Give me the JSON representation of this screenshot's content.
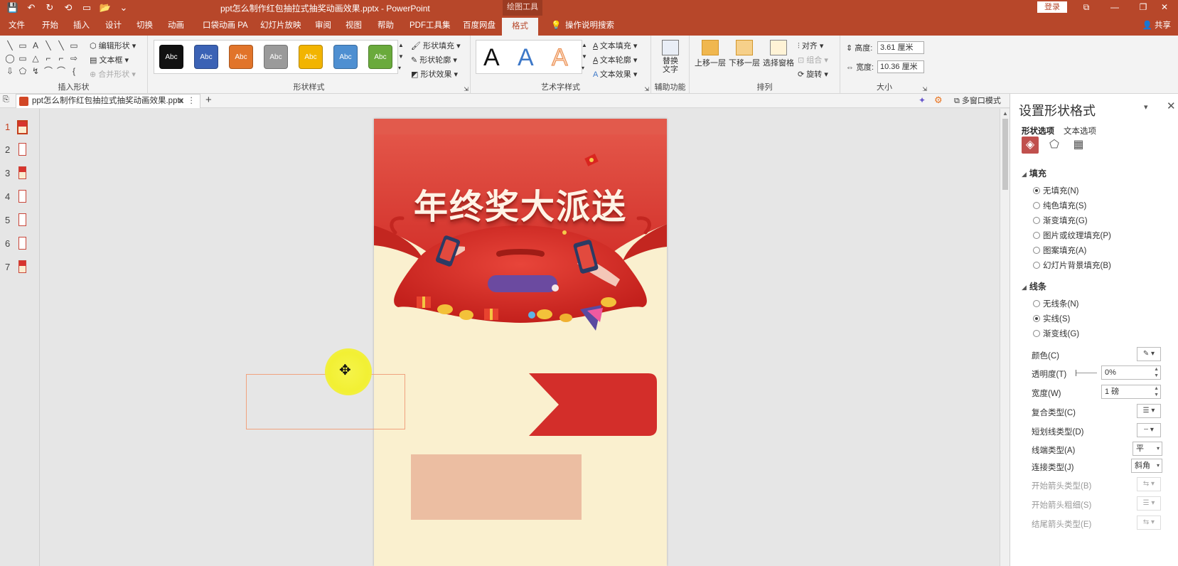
{
  "titlebar": {
    "doc_title": "ppt怎么制作红包抽拉式抽奖动画效果.pptx  -  PowerPoint",
    "context_tool": "绘图工具",
    "login": "登录",
    "minimize_icon": "⧉",
    "restore_icon": "❐",
    "close_icon": "✕",
    "qat": [
      "💾",
      "↶",
      "↻",
      "⟲",
      "▭",
      "📂",
      "⌄"
    ]
  },
  "menu": {
    "tabs": [
      "文件",
      "开始",
      "插入",
      "设计",
      "切换",
      "动画",
      "口袋动画 PA",
      "幻灯片放映",
      "审阅",
      "视图",
      "帮助",
      "PDF工具集",
      "百度网盘",
      "格式"
    ],
    "active": "格式",
    "tell_me": "操作说明搜索",
    "share": "共享"
  },
  "ribbon": {
    "insert_shapes": {
      "label": "插入形状",
      "edit_shape": "编辑形状",
      "text_box": "文本框",
      "merge_shapes": "合并形状",
      "shape_glyphs": [
        "╲",
        "▭",
        "A",
        "╲",
        "╲",
        "▭",
        "◯",
        "▭",
        "△",
        "⌐",
        "⌐",
        "⇨",
        "⇩",
        "⬠",
        "↯",
        "⌒",
        "⌒",
        "{"
      ]
    },
    "shape_styles": {
      "label": "形状样式",
      "swatch_label": "Abc",
      "swatches": [
        "#111111",
        "#3b62b5",
        "#e1742a",
        "#9a9a9a",
        "#f2b400",
        "#4e8fd1",
        "#6aaa3c"
      ],
      "fill": "形状填充",
      "outline": "形状轮廓",
      "effects": "形状效果"
    },
    "wordart": {
      "label": "艺术字样式",
      "letters": [
        {
          "char": "A",
          "color": "#111111"
        },
        {
          "char": "A",
          "color": "#3d78c8"
        },
        {
          "char": "A",
          "color": "#f2b48a"
        }
      ],
      "text_fill": "文本填充",
      "text_outline": "文本轮廓",
      "text_effects": "文本效果"
    },
    "accessibility": {
      "label": "辅助功能",
      "alt_text": "替换文字"
    },
    "arrange": {
      "label": "排列",
      "bring_forward": "上移一层",
      "send_backward": "下移一层",
      "selection_pane": "选择窗格",
      "align": "对齐",
      "group": "组合",
      "rotate": "旋转"
    },
    "size": {
      "label": "大小",
      "height_label": "高度:",
      "height_value": "3.61 厘米",
      "width_label": "宽度:",
      "width_value": "10.36 厘米"
    }
  },
  "tabbar": {
    "doc_tab": "ppt怎么制作红包抽拉式抽奖动画效果.pptx",
    "close": "✕",
    "more": "⋮",
    "plus": "+",
    "multiwindow": "多窗口模式"
  },
  "thumbnails": [
    "1",
    "2",
    "3",
    "4",
    "5",
    "6",
    "7"
  ],
  "slide": {
    "title": "年终奖大派送"
  },
  "pane": {
    "title": "设置形状格式",
    "tabs": [
      "形状选项",
      "文本选项"
    ],
    "fill": {
      "header": "填充",
      "options": [
        "无填充(N)",
        "纯色填充(S)",
        "渐变填充(G)",
        "图片或纹理填充(P)",
        "图案填充(A)",
        "幻灯片背景填充(B)"
      ],
      "selected": 0
    },
    "line": {
      "header": "线条",
      "options": [
        "无线条(N)",
        "实线(S)",
        "渐变线(G)"
      ],
      "selected": 1
    },
    "props": {
      "color": "颜色(C)",
      "transparency": "透明度(T)",
      "transparency_value": "0%",
      "width": "宽度(W)",
      "width_value": "1 磅",
      "compound": "复合类型(C)",
      "dash": "短划线类型(D)",
      "cap": "线端类型(A)",
      "cap_value": "平",
      "join": "连接类型(J)",
      "join_value": "斜角",
      "begin_arrow_type": "开始箭头类型(B)",
      "begin_arrow_size": "开始箭头粗细(S)",
      "end_arrow_type": "结尾箭头类型(E)"
    }
  },
  "colors": {
    "accent": "#b7472a",
    "slide_red": "#d8342e",
    "slide_bg": "#faf0cf",
    "rect_pink": "#ecbea2",
    "cursor_yellow": "#f2f033"
  }
}
